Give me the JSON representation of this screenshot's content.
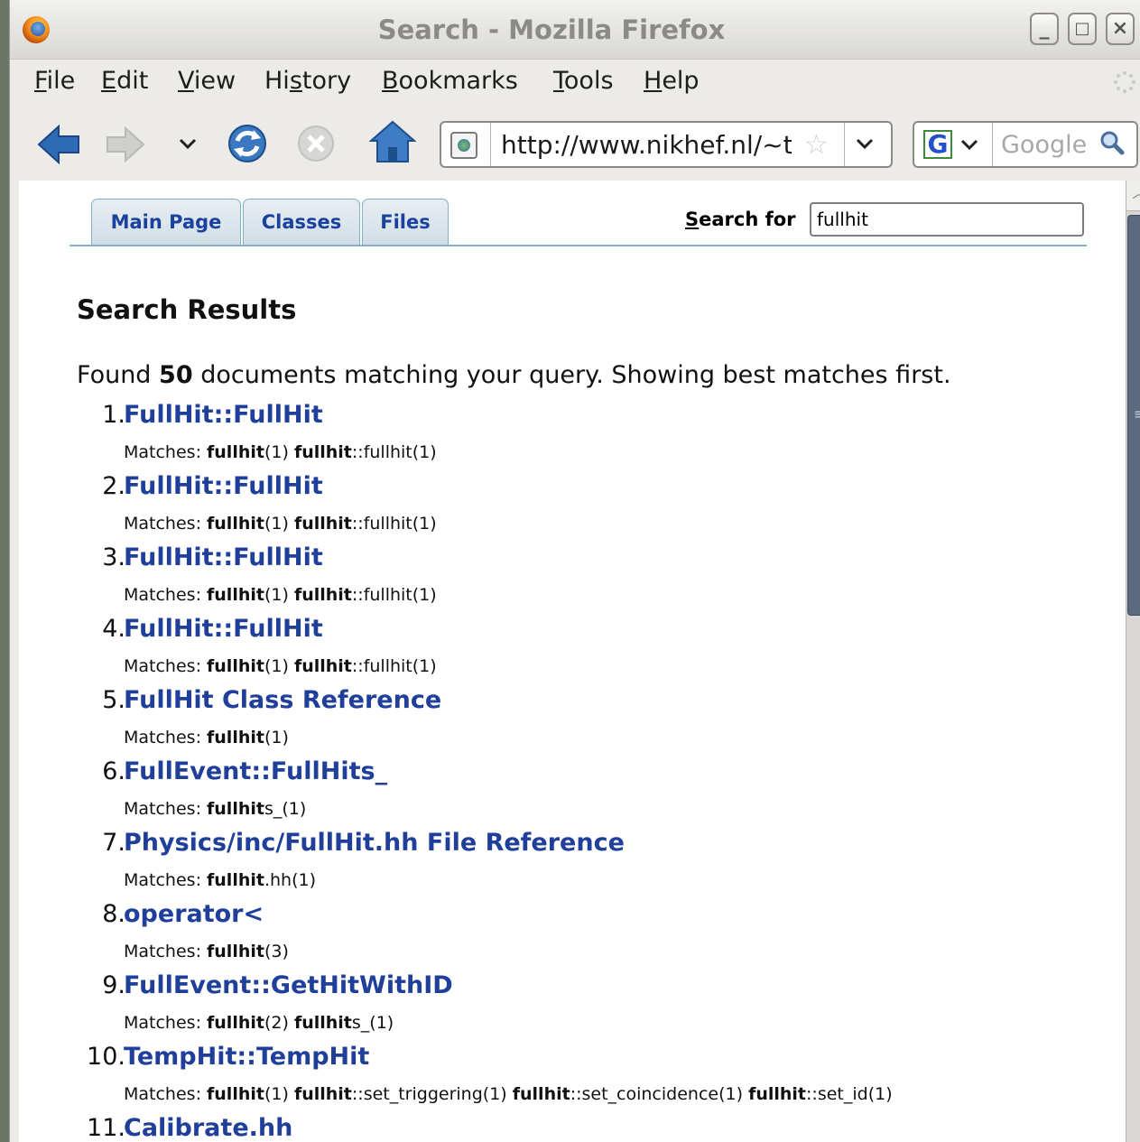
{
  "window": {
    "title": "Search - Mozilla Firefox",
    "controls": {
      "minimize": "_",
      "maximize": "□",
      "close": "×"
    }
  },
  "menu": [
    {
      "label": "File",
      "key": "F",
      "rest": "ile"
    },
    {
      "label": "Edit",
      "key": "E",
      "rest": "dit"
    },
    {
      "label": "View",
      "key": "V",
      "rest": "iew"
    },
    {
      "label": "History",
      "key": "s",
      "pre": "Hi",
      "rest": "tory"
    },
    {
      "label": "Bookmarks",
      "key": "B",
      "rest": "ookmarks"
    },
    {
      "label": "Tools",
      "key": "T",
      "rest": "ools"
    },
    {
      "label": "Help",
      "key": "H",
      "rest": "elp"
    }
  ],
  "toolbar": {
    "url": "http://www.nikhef.nl/~t€",
    "search_engine_placeholder": "Google",
    "google_letter": "G",
    "dropdown_glyph": "⌄",
    "star_glyph": "☆"
  },
  "doxygen": {
    "tabs": [
      "Main Page",
      "Classes",
      "Files"
    ],
    "search_label_key": "S",
    "search_label_rest": "earch for",
    "search_value": "fullhit"
  },
  "results_title": "Search Results",
  "found": {
    "prefix": "Found ",
    "count": "50",
    "suffix": " documents matching your query. Showing best matches first."
  },
  "matches_label": "Matches: ",
  "results": [
    {
      "num": "1.",
      "title": "FullHit::FullHit",
      "matches": [
        [
          "fullhit",
          "(1)"
        ],
        [
          "fullhit",
          "::fullhit(1)"
        ]
      ]
    },
    {
      "num": "2.",
      "title": "FullHit::FullHit",
      "matches": [
        [
          "fullhit",
          "(1)"
        ],
        [
          "fullhit",
          "::fullhit(1)"
        ]
      ]
    },
    {
      "num": "3.",
      "title": "FullHit::FullHit",
      "matches": [
        [
          "fullhit",
          "(1)"
        ],
        [
          "fullhit",
          "::fullhit(1)"
        ]
      ]
    },
    {
      "num": "4.",
      "title": "FullHit::FullHit",
      "matches": [
        [
          "fullhit",
          "(1)"
        ],
        [
          "fullhit",
          "::fullhit(1)"
        ]
      ]
    },
    {
      "num": "5.",
      "title": "FullHit Class Reference",
      "matches": [
        [
          "fullhit",
          "(1)"
        ]
      ]
    },
    {
      "num": "6.",
      "title": "FullEvent::FullHits_",
      "matches": [
        [
          "fullhit",
          "s_(1)"
        ]
      ]
    },
    {
      "num": "7.",
      "title": "Physics/inc/FullHit.hh File Reference",
      "matches": [
        [
          "fullhit",
          ".hh(1)"
        ]
      ]
    },
    {
      "num": "8.",
      "title": "operator<",
      "matches": [
        [
          "fullhit",
          "(3)"
        ]
      ]
    },
    {
      "num": "9.",
      "title": "FullEvent::GetHitWithID",
      "matches": [
        [
          "fullhit",
          "(2)"
        ],
        [
          "fullhit",
          "s_(1)"
        ]
      ]
    },
    {
      "num": "10.",
      "title": "TempHit::TempHit",
      "matches": [
        [
          "fullhit",
          "(1)"
        ],
        [
          "fullhit",
          "::set_triggering(1)"
        ],
        [
          "fullhit",
          "::set_coincidence(1)"
        ],
        [
          "fullhit",
          "::set_id(1)"
        ]
      ]
    },
    {
      "num": "11.",
      "title": "Calibrate.hh",
      "matches": []
    }
  ]
}
